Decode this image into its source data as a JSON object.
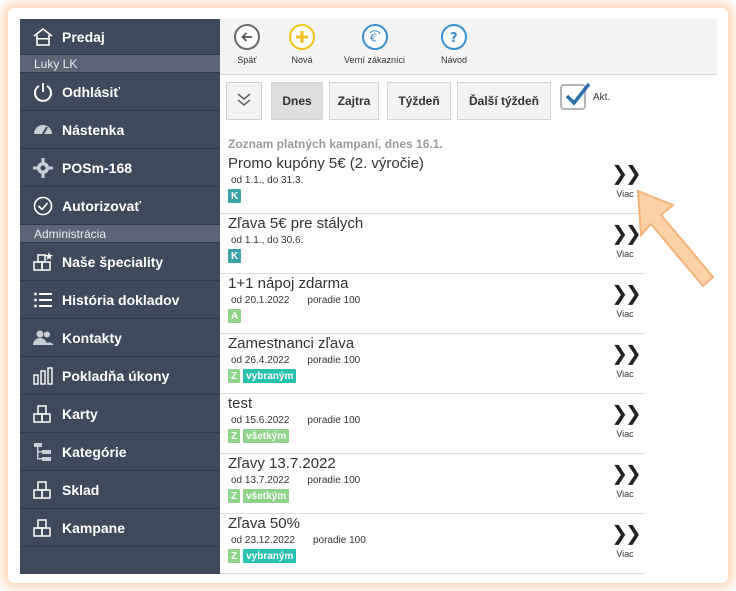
{
  "sidebar": {
    "top_item": {
      "label": "Predaj",
      "icon": "home-icon"
    },
    "user_label": "Luky LK",
    "items": [
      {
        "label": "Odhlásiť",
        "icon": "power-icon",
        "name": "sidebar-item-logout"
      },
      {
        "label": "Nástenka",
        "icon": "dashboard-icon",
        "name": "sidebar-item-dashboard"
      },
      {
        "label": "POSm-168",
        "icon": "gear-icon",
        "name": "sidebar-item-posm"
      },
      {
        "label": "Autorizovať",
        "icon": "check-circle-icon",
        "name": "sidebar-item-authorize"
      }
    ],
    "admin_label": "Administrácia",
    "admin_items": [
      {
        "label": "Naše špeciality",
        "icon": "specialties-icon",
        "name": "sidebar-item-specialties"
      },
      {
        "label": "História dokladov",
        "icon": "list-icon",
        "name": "sidebar-item-history"
      },
      {
        "label": "Kontakty",
        "icon": "contacts-icon",
        "name": "sidebar-item-contacts"
      },
      {
        "label": "Pokladňa úkony",
        "icon": "bar-chart-icon",
        "name": "sidebar-item-cashier"
      },
      {
        "label": "Karty",
        "icon": "cards-icon",
        "name": "sidebar-item-cards"
      },
      {
        "label": "Kategórie",
        "icon": "tree-icon",
        "name": "sidebar-item-categories"
      },
      {
        "label": "Sklad",
        "icon": "stock-icon",
        "name": "sidebar-item-stock"
      },
      {
        "label": "Kampane",
        "icon": "campaigns-icon",
        "name": "sidebar-item-campaigns"
      }
    ]
  },
  "toolbar": {
    "back_label": "Späť",
    "new_label": "Nová",
    "loyal_label": "Verní zákazníci",
    "help_label": "Návod",
    "colors": {
      "back": "#6b6b6b",
      "new": "#f2c21b",
      "loyal": "#3a8fd0",
      "help": "#3a8fd0"
    }
  },
  "datebar": {
    "today": "Dnes",
    "tomorrow": "Zajtra",
    "week": "Týždeň",
    "next_week": "Ďalší týždeň",
    "active_label": "Akt.",
    "active_checked": true
  },
  "list_title": "Zoznam platných kampaní, dnes 16.1.",
  "campaigns": [
    {
      "name": "Promo kupóny 5€ (2. výročie)",
      "period": "od 1.1., do 31.3.",
      "order": "",
      "tags": [
        {
          "text": "K",
          "color": "#3aa3a8"
        }
      ],
      "more": "Viac"
    },
    {
      "name": "Zľava 5€ pre stálych",
      "period": "od 1.1., do 30.6.",
      "order": "",
      "tags": [
        {
          "text": "K",
          "color": "#3aa3a8"
        }
      ],
      "more": "Viac"
    },
    {
      "name": "1+1 nápoj zdarma",
      "period": "od 20.1.2022",
      "order": "poradie 100",
      "tags": [
        {
          "text": "A",
          "color": "#8fd48a"
        }
      ],
      "more": "Viac"
    },
    {
      "name": "Zamestnanci zľava",
      "period": "od 26.4.2022",
      "order": "poradie 100",
      "tags": [
        {
          "text": "Z",
          "color": "#8fd48a"
        },
        {
          "text": "vybraným",
          "color": "#27c1b0"
        }
      ],
      "more": "Viac"
    },
    {
      "name": "test",
      "period": "od 15.6.2022",
      "order": "poradie 100",
      "tags": [
        {
          "text": "Z",
          "color": "#8fd48a"
        },
        {
          "text": "všetkým",
          "color": "#8fd48a"
        }
      ],
      "more": "Viac"
    },
    {
      "name": "Zľavy 13.7.2022",
      "period": "od 13.7.2022",
      "order": "poradie 100",
      "tags": [
        {
          "text": "Z",
          "color": "#8fd48a"
        },
        {
          "text": "všetkým",
          "color": "#8fd48a"
        }
      ],
      "more": "Viac"
    },
    {
      "name": "Zľava 50%",
      "period": "od 23.12.2022",
      "order": "poradie 100",
      "tags": [
        {
          "text": "Z",
          "color": "#8fd48a"
        },
        {
          "text": "vybraným",
          "color": "#27c1b0"
        }
      ],
      "more": "Viac"
    }
  ]
}
